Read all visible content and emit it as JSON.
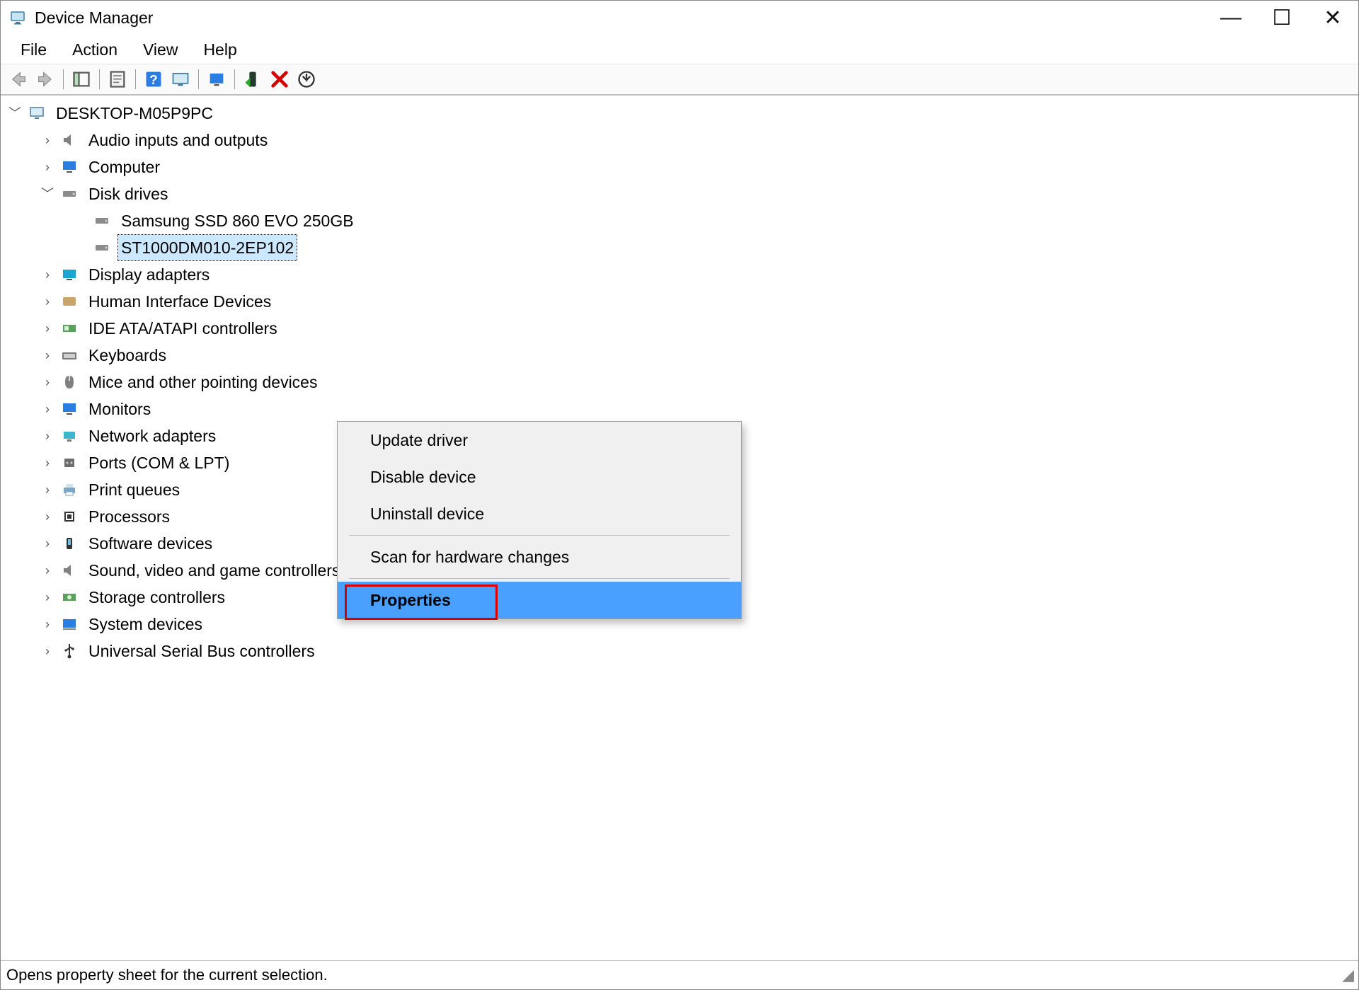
{
  "window": {
    "title": "Device Manager"
  },
  "window_controls": {
    "minimize": "—",
    "maximize": "☐",
    "close": "✕"
  },
  "menu": [
    "File",
    "Action",
    "View",
    "Help"
  ],
  "tree": {
    "root": "DESKTOP-M05P9PC",
    "categories": [
      {
        "label": "Audio inputs and outputs"
      },
      {
        "label": "Computer"
      },
      {
        "label": "Disk drives",
        "expanded": true,
        "children": [
          {
            "label": "Samsung SSD 860 EVO 250GB"
          },
          {
            "label": "ST1000DM010-2EP102",
            "selected": true
          }
        ]
      },
      {
        "label": "Display adapters"
      },
      {
        "label": "Human Interface Devices"
      },
      {
        "label": "IDE ATA/ATAPI controllers"
      },
      {
        "label": "Keyboards"
      },
      {
        "label": "Mice and other pointing devices"
      },
      {
        "label": "Monitors"
      },
      {
        "label": "Network adapters"
      },
      {
        "label": "Ports (COM & LPT)"
      },
      {
        "label": "Print queues"
      },
      {
        "label": "Processors"
      },
      {
        "label": "Software devices"
      },
      {
        "label": "Sound, video and game controllers"
      },
      {
        "label": "Storage controllers"
      },
      {
        "label": "System devices"
      },
      {
        "label": "Universal Serial Bus controllers"
      }
    ]
  },
  "context_menu": {
    "items": [
      {
        "label": "Update driver"
      },
      {
        "label": "Disable device"
      },
      {
        "label": "Uninstall device"
      },
      {
        "sep": true
      },
      {
        "label": "Scan for hardware changes"
      },
      {
        "sep": true
      },
      {
        "label": "Properties",
        "highlight": true
      }
    ]
  },
  "statusbar": {
    "text": "Opens property sheet for the current selection."
  }
}
